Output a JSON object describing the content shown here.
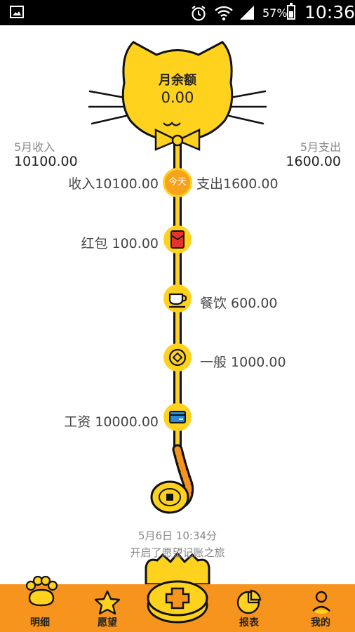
{
  "status_bar": {
    "battery": "57%",
    "time": "10:36"
  },
  "summary": {
    "income_label": "5月收入",
    "income_value": "10100.00",
    "expense_label": "5月支出",
    "expense_value": "1600.00",
    "balance_title": "月余额",
    "balance_value": "0.00"
  },
  "today_row": {
    "income": "收入10100.00",
    "badge": "今天",
    "expense": "支出1600.00"
  },
  "entries": [
    {
      "label": "红包 100.00",
      "icon": "red-envelope-icon",
      "side": "left"
    },
    {
      "label": "餐饮 600.00",
      "icon": "coffee-cup-icon",
      "side": "right"
    },
    {
      "label": "一般 1000.00",
      "icon": "coin-icon",
      "side": "right"
    },
    {
      "label": "工资 10000.00",
      "icon": "card-icon",
      "side": "left"
    }
  ],
  "footer": {
    "date": "5月6日 10:34分",
    "note": "开启了愿望记账之旅"
  },
  "tabs": [
    {
      "label": "明细",
      "icon": "paw-icon"
    },
    {
      "label": "愿望",
      "icon": "star-icon"
    },
    {
      "label": "",
      "icon": "add-icon"
    },
    {
      "label": "报表",
      "icon": "pie-chart-icon"
    },
    {
      "label": "我的",
      "icon": "person-icon"
    }
  ],
  "colors": {
    "accent": "#ffd21e",
    "tab_bar": "#f7941d",
    "today_badge": "#f7a21b",
    "red_envelope": "#e8322e"
  }
}
